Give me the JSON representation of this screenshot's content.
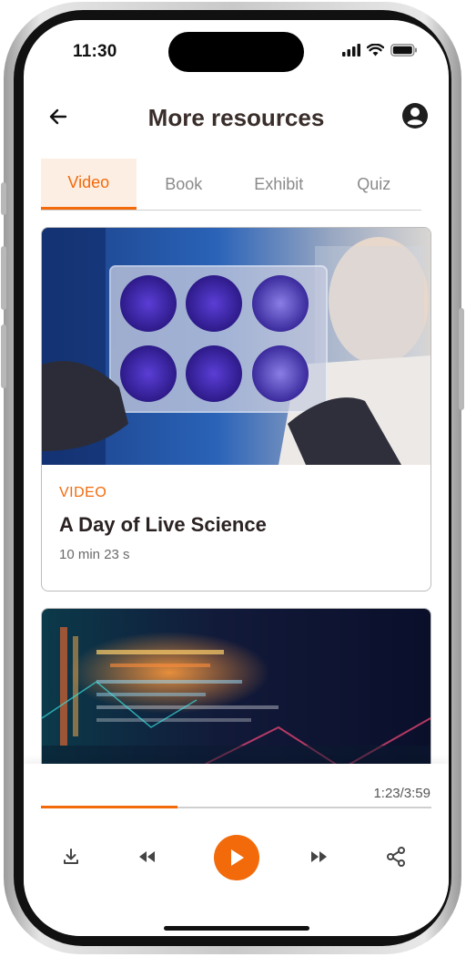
{
  "status_bar": {
    "time": "11:30",
    "icons": [
      "signal-icon",
      "wifi-icon",
      "battery-icon"
    ]
  },
  "header": {
    "title": "More resources",
    "back_icon": "back-arrow-icon",
    "profile_icon": "account-circle-icon"
  },
  "tabs": [
    {
      "label": "Video",
      "active": true
    },
    {
      "label": "Book",
      "active": false
    },
    {
      "label": "Exhibit",
      "active": false
    },
    {
      "label": "Quiz",
      "active": false
    }
  ],
  "cards": [
    {
      "type": "VIDEO",
      "title": "A Day of Live Science",
      "duration": "10 min 23 s",
      "image": "scientist-with-petri-plates"
    },
    {
      "image": "code-data-visualization"
    }
  ],
  "player": {
    "elapsed_total": "1:23/3:59",
    "progress_fraction": 0.35
  },
  "colors": {
    "accent": "#f26a0a",
    "title_text": "#3a2e2b",
    "tab_active_bg": "#fdeee3"
  }
}
